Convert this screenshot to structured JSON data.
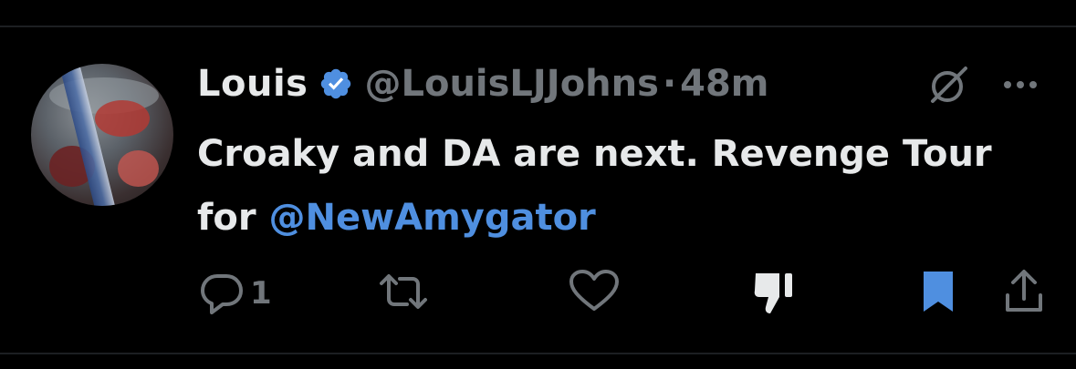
{
  "tweet": {
    "author_name": "Louis",
    "handle": "@LouisLJJohns",
    "separator": "·",
    "time": "48m",
    "text_part1": "Croaky and DA are next. Revenge Tour for ",
    "mention": "@NewAmygator"
  },
  "actions": {
    "reply_count": "1"
  },
  "colors": {
    "background": "#000000",
    "text": "#e7e9ea",
    "muted": "#71767b",
    "accent": "#4f8fe0",
    "verified": "#4f8fe0"
  },
  "icons": {
    "verified": "verified-badge-icon",
    "grok": "grok-icon",
    "more": "more-icon",
    "reply": "reply-icon",
    "retweet": "retweet-icon",
    "like": "heart-icon",
    "dislike": "thumbs-down-icon",
    "bookmark": "bookmark-icon",
    "share": "share-icon"
  }
}
